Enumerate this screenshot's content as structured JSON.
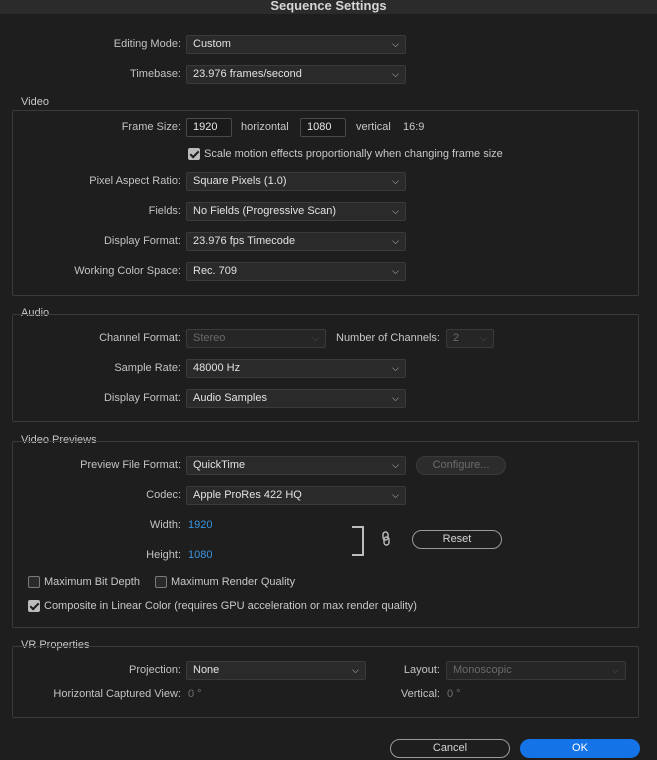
{
  "window": {
    "title": "Sequence Settings"
  },
  "general": {
    "editing_mode_label": "Editing Mode:",
    "editing_mode_value": "Custom",
    "timebase_label": "Timebase:",
    "timebase_value": "23.976  frames/second"
  },
  "video": {
    "group_title": "Video",
    "frame_size_label": "Frame Size:",
    "frame_width": "1920",
    "horizontal_label": "horizontal",
    "frame_height": "1080",
    "vertical_label": "vertical",
    "aspect": "16:9",
    "scale_motion_label": "Scale motion effects proportionally when changing frame size",
    "scale_motion_checked": true,
    "pixel_aspect_label": "Pixel Aspect Ratio:",
    "pixel_aspect_value": "Square Pixels (1.0)",
    "fields_label": "Fields:",
    "fields_value": "No Fields (Progressive Scan)",
    "display_format_label": "Display Format:",
    "display_format_value": "23.976 fps Timecode",
    "color_space_label": "Working Color Space:",
    "color_space_value": "Rec. 709"
  },
  "audio": {
    "group_title": "Audio",
    "channel_format_label": "Channel Format:",
    "channel_format_value": "Stereo",
    "num_channels_label": "Number of Channels:",
    "num_channels_value": "2",
    "sample_rate_label": "Sample Rate:",
    "sample_rate_value": "48000 Hz",
    "display_format_label": "Display Format:",
    "display_format_value": "Audio Samples"
  },
  "previews": {
    "group_title": "Video Previews",
    "file_format_label": "Preview File Format:",
    "file_format_value": "QuickTime",
    "configure_label": "Configure...",
    "codec_label": "Codec:",
    "codec_value": "Apple ProRes 422 HQ",
    "width_label": "Width:",
    "width_value": "1920",
    "height_label": "Height:",
    "height_value": "1080",
    "reset_label": "Reset",
    "max_bit_depth_label": "Maximum Bit Depth",
    "max_bit_depth_checked": false,
    "max_render_quality_label": "Maximum Render Quality",
    "max_render_quality_checked": false,
    "linear_color_label": "Composite in Linear Color (requires GPU acceleration or max render quality)",
    "linear_color_checked": true
  },
  "vr": {
    "group_title": "VR Properties",
    "projection_label": "Projection:",
    "projection_value": "None",
    "layout_label": "Layout:",
    "layout_value": "Monoscopic",
    "h_view_label": "Horizontal Captured View:",
    "h_view_value": "0 °",
    "vertical_label": "Vertical:",
    "vertical_value": "0 °"
  },
  "footer": {
    "cancel_label": "Cancel",
    "ok_label": "OK"
  },
  "icons": {
    "chevron": "chevron-down-icon",
    "link": "link-icon"
  },
  "colors": {
    "accent": "#1473e6",
    "value_blue": "#3b94e0",
    "background": "#1e1e1e"
  }
}
